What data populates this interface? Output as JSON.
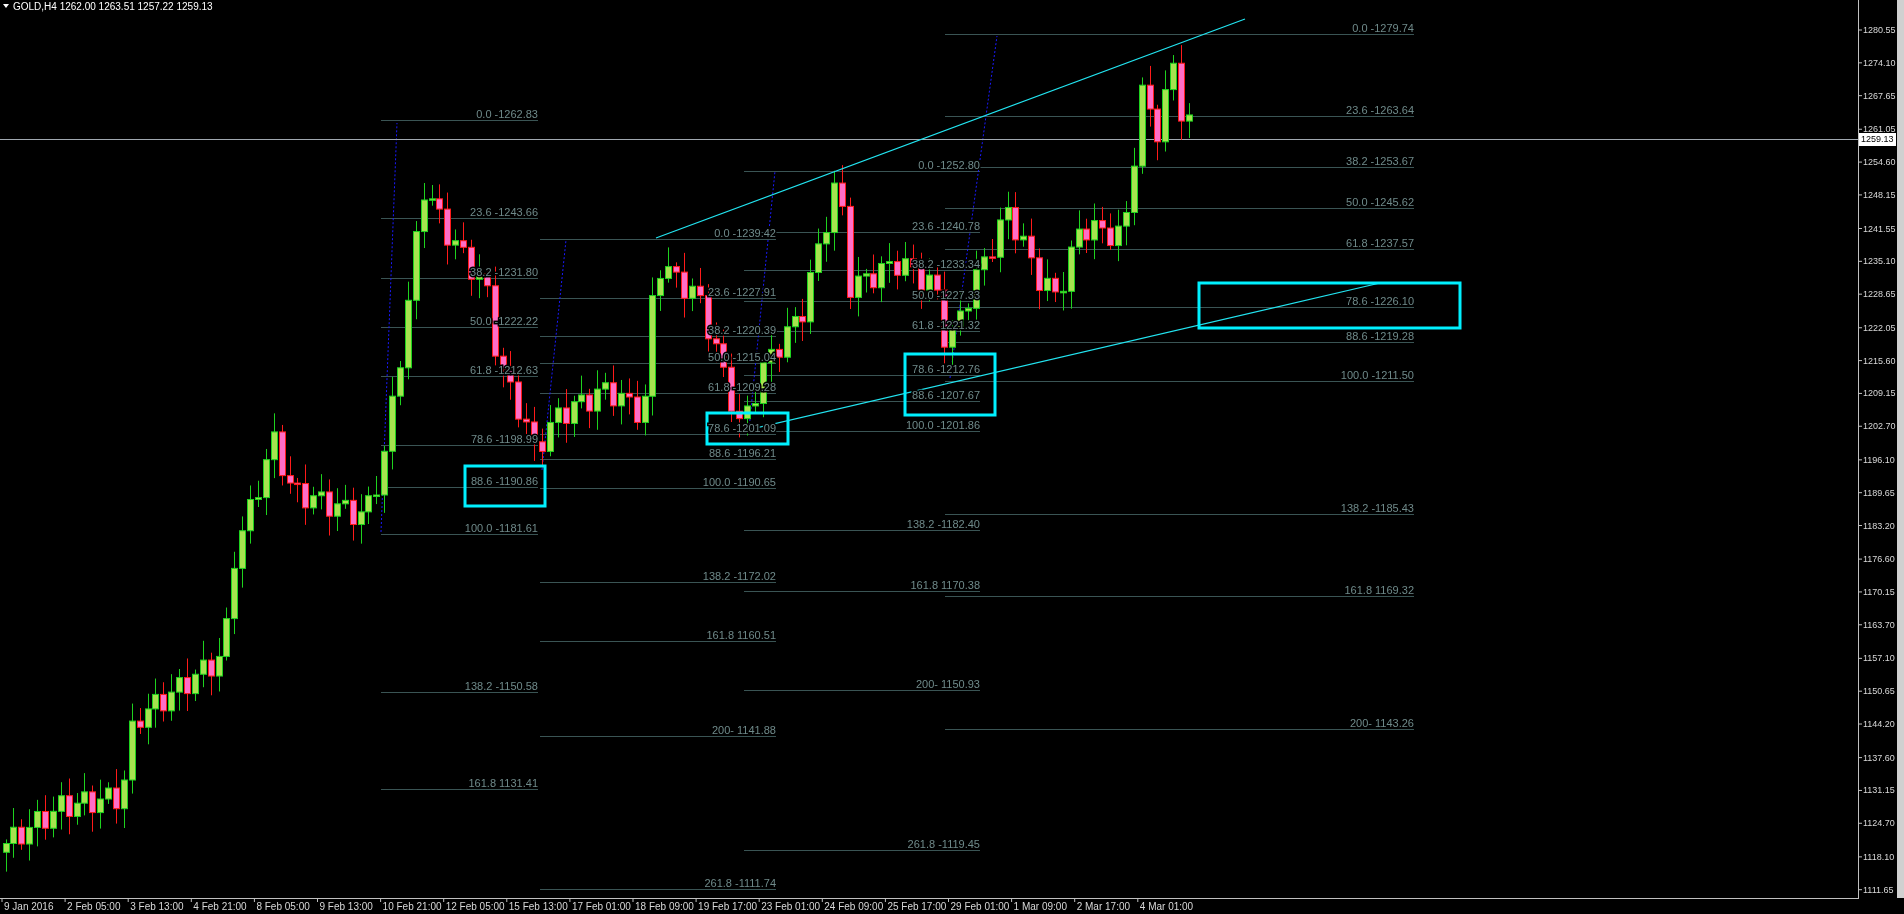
{
  "chart": {
    "symbol_info": "GOLD,H4  1262.00 1263.51 1257.22 1259.13",
    "current_price": "1259.13",
    "price_axis": [
      "1280.55",
      "1274.10",
      "1267.65",
      "1261.05",
      "1254.60",
      "1248.15",
      "1241.55",
      "1235.10",
      "1228.65",
      "1222.05",
      "1215.60",
      "1209.15",
      "1202.70",
      "1196.10",
      "1189.65",
      "1183.20",
      "1176.60",
      "1170.15",
      "1163.70",
      "1157.10",
      "1150.65",
      "1144.20",
      "1137.60",
      "1131.15",
      "1124.70",
      "1118.10",
      "1111.65"
    ],
    "time_axis": [
      "9 Jan 2016",
      "2 Feb 05:00",
      "3 Feb 13:00",
      "4 Feb 21:00",
      "8 Feb 05:00",
      "9 Feb 13:00",
      "10 Feb 21:00",
      "12 Feb 05:00",
      "15 Feb 13:00",
      "17 Feb 01:00",
      "18 Feb 09:00",
      "19 Feb 17:00",
      "23 Feb 01:00",
      "24 Feb 09:00",
      "25 Feb 17:00",
      "29 Feb 01:00",
      "1 Mar 09:00",
      "2 Mar 17:00",
      "4 Mar 01:00"
    ],
    "fibonacci_sets": [
      {
        "levels": [
          "0.0 -1262.83",
          "23.6 -1243.66",
          "38.2 -1231.80",
          "50.0 -1222.22",
          "61.8 -1212.63",
          "78.6 -1198.99",
          "88.6 -1190.86",
          "100.0 -1181.61",
          "138.2  -1150.58",
          "161.8 1131.41"
        ]
      },
      {
        "levels": [
          "0.0 -1239.42",
          "23.6 -1227.91",
          "38.2 -1220.39",
          "50.0 -1215.04",
          "61.8 -1209.28",
          "78.6 -1201.09",
          "88.6 -1196.21",
          "100.0 -1190.65",
          "138.2  -1172.02",
          "161.8 1160.51",
          "200- 1141.88",
          "261.8 -1111.74"
        ]
      },
      {
        "levels": [
          "0.0 -1252.80",
          "23.6 -1240.78",
          "38.2 -1233.34",
          "50.0 -1227.33",
          "61.8 -1221.32",
          "78.6 -1212.76",
          "88.6 -1207.67",
          "100.0 -1201.86",
          "138.2  -1182.40",
          "161.8 1170.38",
          "200- 1150.93",
          "261.8 -1119.45"
        ]
      },
      {
        "levels": [
          "0.0 -1279.74",
          "23.6 -1263.64",
          "38.2 -1253.67",
          "50.0 -1245.62",
          "61.8 -1237.57",
          "78.6 -1226.10",
          "88.6 -1219.28",
          "100.0 -1211.50",
          "138.2  -1185.43",
          "161.8 1169.32",
          "200- 1143.26"
        ]
      }
    ]
  }
}
